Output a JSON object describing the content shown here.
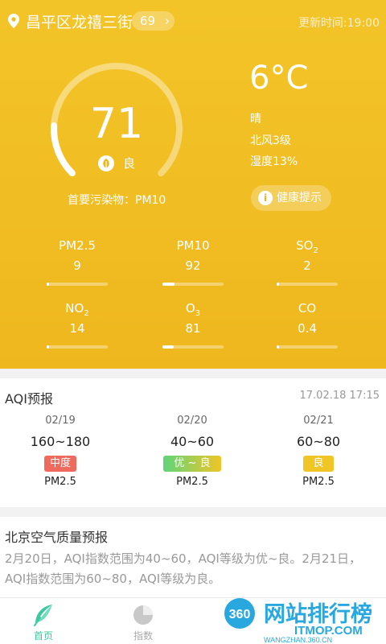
{
  "header": {
    "location": "昌平区龙禧三街",
    "aqi_badge": "69",
    "update_time": "更新时间:19:00"
  },
  "current": {
    "aqi": "71",
    "aqi_ratio": 0.71,
    "level": "良",
    "primary_pollutant": "首要污染物：PM10",
    "temperature": "6°C",
    "weather": "晴",
    "wind": "北风3级",
    "humidity": "湿度13%",
    "health_button": "健康提示"
  },
  "pollutants": [
    {
      "name": "PM2.5",
      "sub": "",
      "value": "9",
      "fill": 0.04
    },
    {
      "name": "PM10",
      "sub": "",
      "value": "92",
      "fill": 0.2
    },
    {
      "name": "SO",
      "sub": "2",
      "value": "2",
      "fill": 0.02
    },
    {
      "name": "NO",
      "sub": "2",
      "value": "14",
      "fill": 0.04
    },
    {
      "name": "O",
      "sub": "3",
      "value": "81",
      "fill": 0.18
    },
    {
      "name": "CO",
      "sub": "",
      "value": "0.4",
      "fill": 0.02
    }
  ],
  "aqi_forecast": {
    "title": "AQI预报",
    "published": "17.02.18 17:15",
    "days": [
      {
        "date": "02/19",
        "range": "160~180",
        "level": "中度",
        "pollutant": "PM2.5",
        "color": "#ef6a5d",
        "gradient": ""
      },
      {
        "date": "02/20",
        "range": "40~60",
        "level": "优 ~ 良",
        "pollutant": "PM2.5",
        "color": "#5fd57a",
        "gradient": "#f0c526"
      },
      {
        "date": "02/21",
        "range": "60~80",
        "level": "良",
        "pollutant": "PM2.5",
        "color": "#f0c526",
        "gradient": ""
      }
    ]
  },
  "beijing_forecast": {
    "title": "北京空气质量预报",
    "text": "2月20日，AQI指数范围为40~60，AQI等级为优~良。2月21日，AQI指数范围为60~80，AQI等级为良。"
  },
  "tabs": [
    {
      "label": "首页",
      "active": true
    },
    {
      "label": "指数",
      "active": false
    },
    {
      "label": "",
      "active": false
    },
    {
      "label": "",
      "active": false
    }
  ],
  "watermark": {
    "logo": "360",
    "name": "网站排行榜",
    "domain": "ITMOP.COM",
    "url": "WANGZHAN.360.CN"
  },
  "colors": {
    "accent_green": "#3cc9a0",
    "tab_inactive": "#aaaaaa",
    "hero_yellow": "#f0bd22"
  }
}
